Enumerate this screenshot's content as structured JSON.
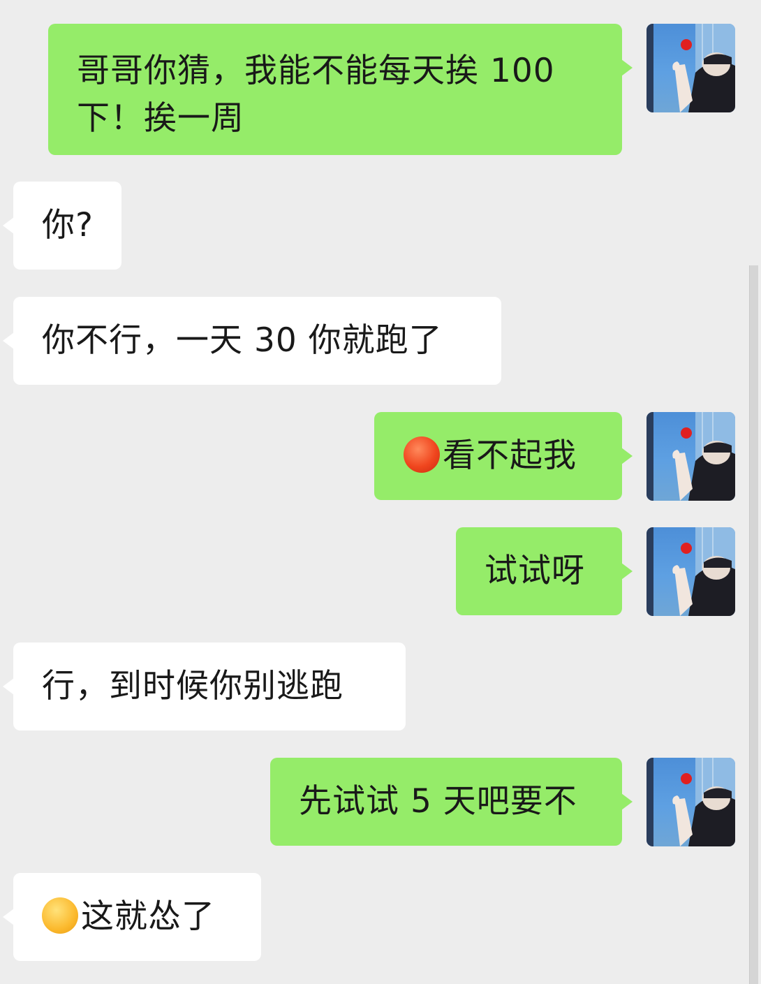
{
  "chat": {
    "messages": [
      {
        "id": 1,
        "side": "sent",
        "lines": [
          "哥哥你猜，我能不能每天挨 100",
          "下！挨一周"
        ]
      },
      {
        "id": 2,
        "side": "recv",
        "lines": [
          "你?"
        ]
      },
      {
        "id": 3,
        "side": "recv",
        "lines": [
          "你不行，一天 30 你就跑了"
        ]
      },
      {
        "id": 4,
        "side": "sent",
        "emoji": "angry-face-emoji",
        "lines": [
          "看不起我"
        ]
      },
      {
        "id": 5,
        "side": "sent",
        "lines": [
          "试试呀"
        ]
      },
      {
        "id": 6,
        "side": "recv",
        "lines": [
          "行，到时候你别逃跑"
        ]
      },
      {
        "id": 7,
        "side": "sent",
        "lines": [
          "先试试 5 天吧要不"
        ]
      },
      {
        "id": 8,
        "side": "recv",
        "emoji": "smirk-face-emoji",
        "lines": [
          "这就怂了"
        ]
      }
    ]
  },
  "colors": {
    "background": "#ededed",
    "sent_bubble": "#95ec69",
    "received_bubble": "#ffffff",
    "text": "#191919"
  }
}
